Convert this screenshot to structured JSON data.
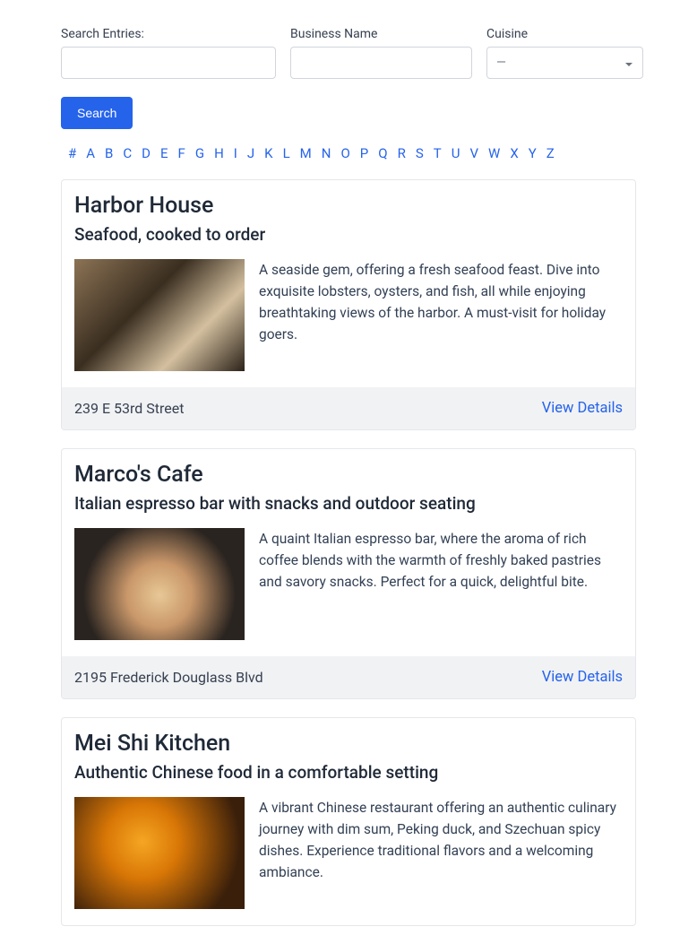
{
  "search": {
    "entriesLabel": "Search Entries:",
    "entriesValue": "",
    "businessLabel": "Business Name",
    "businessValue": "",
    "cuisineLabel": "Cuisine",
    "cuisineSelected": "—",
    "buttonLabel": "Search"
  },
  "alphaNav": [
    "#",
    "A",
    "B",
    "C",
    "D",
    "E",
    "F",
    "G",
    "H",
    "I",
    "J",
    "K",
    "L",
    "M",
    "N",
    "O",
    "P",
    "Q",
    "R",
    "S",
    "T",
    "U",
    "V",
    "W",
    "X",
    "Y",
    "Z"
  ],
  "viewDetailsLabel": "View Details",
  "listings": [
    {
      "name": "Harbor House",
      "tagline": "Seafood, cooked to order",
      "description": "A seaside gem, offering a fresh seafood feast. Dive into exquisite lobsters, oysters, and fish, all while enjoying breathtaking views of the harbor. A must-visit for holiday goers.",
      "address": "239 E 53rd Street",
      "imageAlt": "chef-plating-food"
    },
    {
      "name": "Marco's Cafe",
      "tagline": "Italian espresso bar with snacks and outdoor seating",
      "description": "A quaint Italian espresso bar, where the aroma of rich coffee blends with the warmth of freshly baked pastries and savory snacks. Perfect for a quick, delightful bite.",
      "address": "2195 Frederick Douglass Blvd",
      "imageAlt": "latte-art-coffee"
    },
    {
      "name": "Mei Shi Kitchen",
      "tagline": "Authentic Chinese food in a comfortable setting",
      "description": "A vibrant Chinese restaurant offering an authentic culinary journey with dim sum, Peking duck, and Szechuan spicy dishes. Experience traditional flavors and a welcoming ambiance.",
      "address": "",
      "imageAlt": "chinese-lanterns"
    }
  ]
}
